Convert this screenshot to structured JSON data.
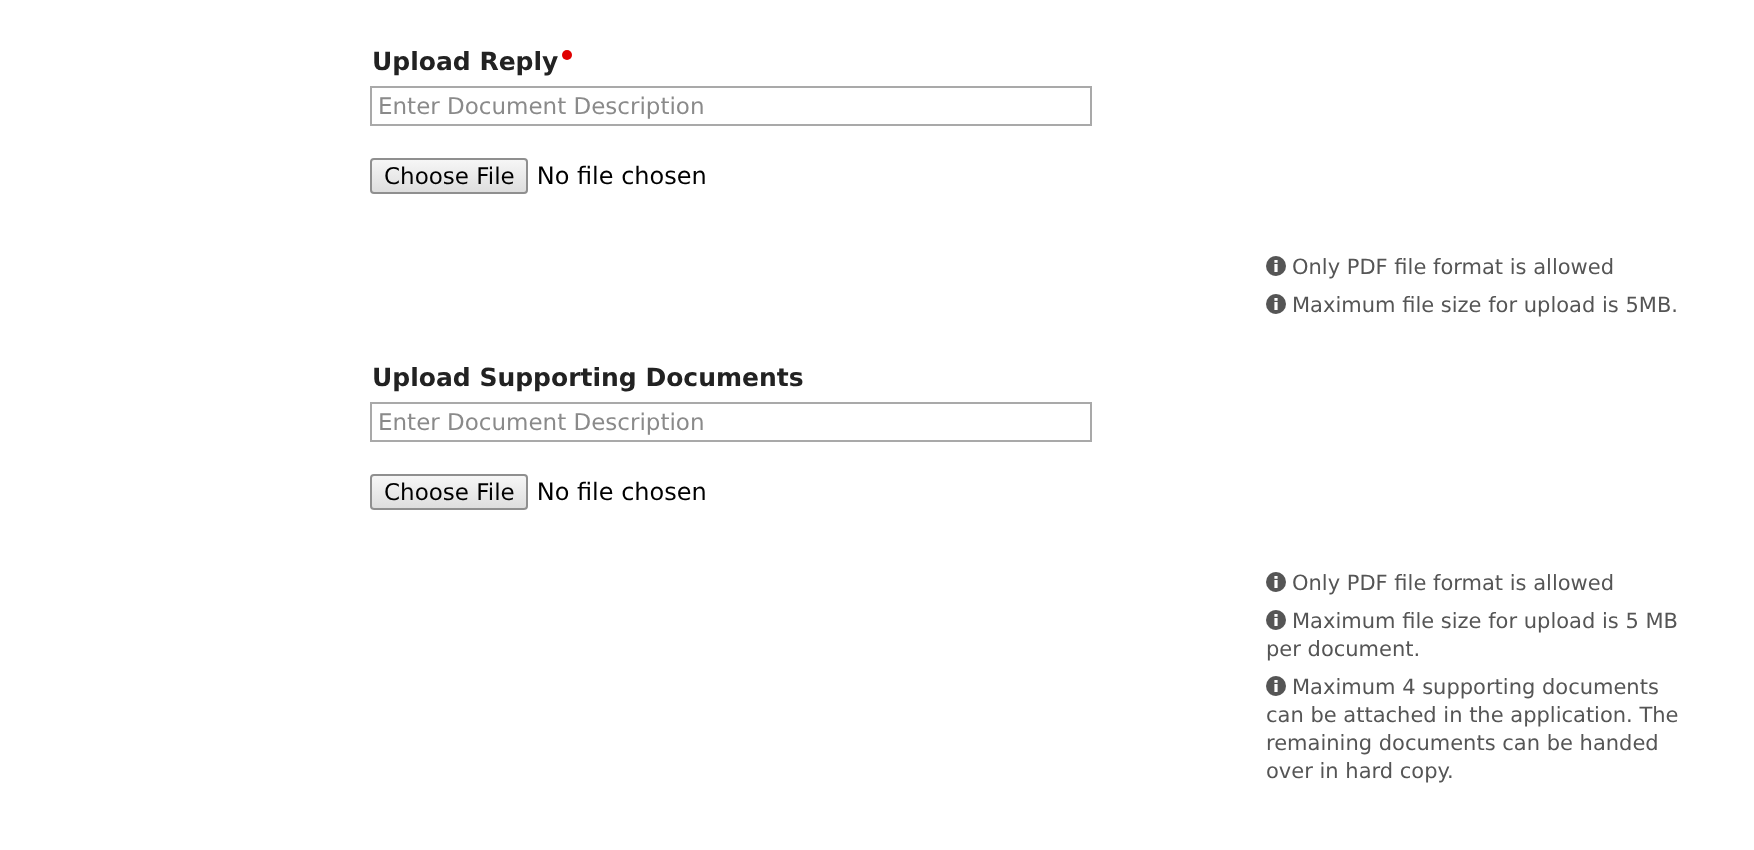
{
  "sections": [
    {
      "title": "Upload Reply",
      "required": true,
      "description": {
        "placeholder": "Enter Document Description"
      },
      "file_button": "Choose File",
      "file_status": "No file chosen",
      "notes": [
        "Only PDF file format is allowed",
        "Maximum file size for upload is 5MB."
      ]
    },
    {
      "title": "Upload Supporting Documents",
      "required": false,
      "description": {
        "placeholder": "Enter Document Description"
      },
      "file_button": "Choose File",
      "file_status": "No file chosen",
      "notes": [
        "Only PDF file format is allowed",
        "Maximum file size for upload is 5 MB per document.",
        "Maximum 4 supporting documents can be attached in the application. The remaining documents can be handed over in hard copy."
      ]
    }
  ]
}
